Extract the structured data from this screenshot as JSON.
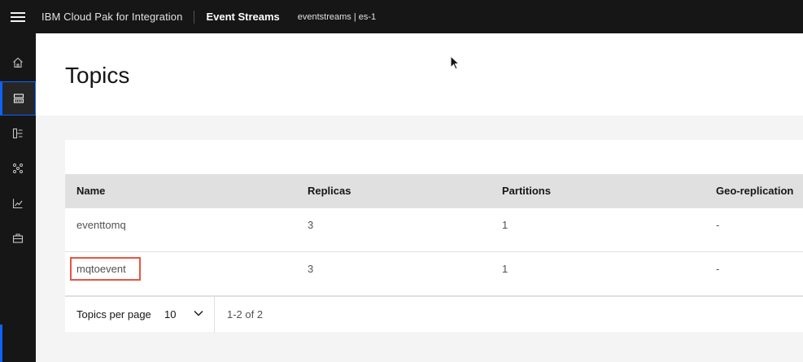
{
  "header": {
    "product": "IBM Cloud Pak for Integration",
    "app": "Event Streams",
    "instance": "eventstreams | es-1"
  },
  "sidebar": {
    "items": [
      {
        "icon": "home-icon"
      },
      {
        "icon": "topics-icon",
        "active": true
      },
      {
        "icon": "schema-icon"
      },
      {
        "icon": "consumer-groups-icon"
      },
      {
        "icon": "monitoring-icon"
      },
      {
        "icon": "toolbox-icon"
      }
    ]
  },
  "page": {
    "title": "Topics"
  },
  "table": {
    "headers": [
      "Name",
      "Replicas",
      "Partitions",
      "Geo-replication"
    ],
    "rows": [
      {
        "name": "eventtomq",
        "replicas": "3",
        "partitions": "1",
        "geo": "-"
      },
      {
        "name": "mqtoevent",
        "replicas": "3",
        "partitions": "1",
        "geo": "-",
        "highlighted": true
      }
    ]
  },
  "pagination": {
    "per_page_label": "Topics per page",
    "per_page_value": "10",
    "range": "1-2 of 2"
  },
  "colors": {
    "header_bg": "#161616",
    "active_accent": "#0f62fe",
    "highlight": "#e8553f"
  }
}
